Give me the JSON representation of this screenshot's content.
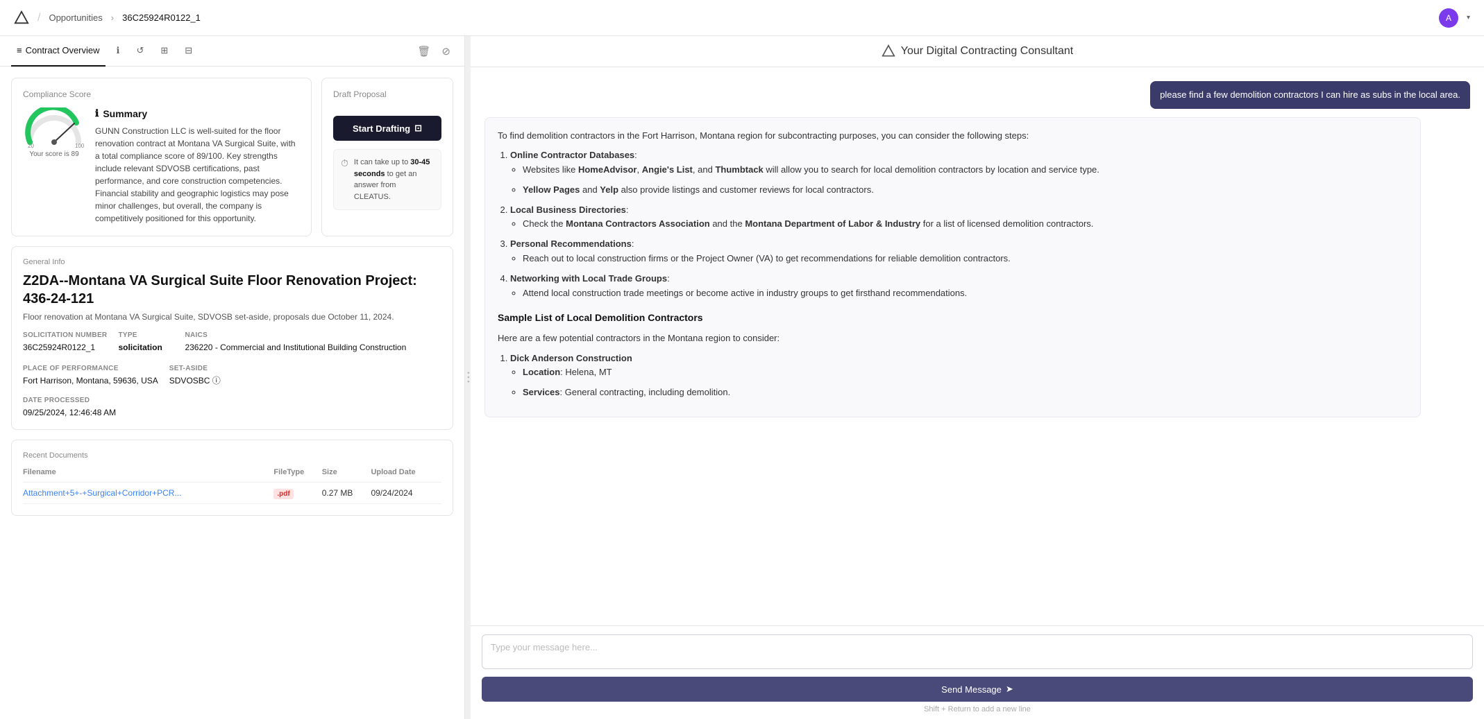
{
  "nav": {
    "breadcrumb": "Opportunities",
    "separator": "/",
    "arrow": "›",
    "current": "36C25924R0122_1",
    "avatar_text": "A",
    "chevron": "▾"
  },
  "tabs": [
    {
      "id": "contract-overview",
      "label": "Contract Overview",
      "icon": "≡",
      "active": true
    },
    {
      "id": "info",
      "label": "",
      "icon": "ℹ",
      "active": false
    },
    {
      "id": "refresh",
      "label": "",
      "icon": "↺",
      "active": false
    },
    {
      "id": "layers",
      "label": "",
      "icon": "⊞",
      "active": false
    },
    {
      "id": "edit",
      "label": "",
      "icon": "⊟",
      "active": false
    }
  ],
  "tab_actions": {
    "delete": "🗑",
    "archive": "⊘"
  },
  "compliance": {
    "section_title": "Compliance Score",
    "score": 89,
    "score_label": "Your score is 89",
    "gauge_min": 20,
    "gauge_max": 100,
    "summary": {
      "title": "Summary",
      "info_icon": "ℹ",
      "text": "GUNN Construction LLC is well-suited for the floor renovation contract at Montana VA Surgical Suite, with a total compliance score of 89/100. Key strengths include relevant SDVOSB certifications, past performance, and core construction competencies. Financial stability and geographic logistics may pose minor challenges, but overall, the company is competitively positioned for this opportunity."
    }
  },
  "draft_proposal": {
    "section_title": "Draft Proposal",
    "button_label": "Start Drafting",
    "button_icon": "⊡",
    "hint_text_1": "It can take up to ",
    "hint_bold": "30-45 seconds",
    "hint_text_2": " to get an answer from CLEATUS."
  },
  "general_info": {
    "section_label": "General Info",
    "project_title": "Z2DA--Montana VA Surgical Suite Floor Renovation Project: 436-24-121",
    "project_subtitle": "Floor renovation at Montana VA Surgical Suite, SDVOSB set-aside, proposals due October 11, 2024.",
    "fields": [
      {
        "label": "SOLICITATION NUMBER",
        "value": "36C25924R0122_1"
      },
      {
        "label": "TYPE",
        "value": "solicitation"
      },
      {
        "label": "NAICS",
        "value": "236220 - Commercial and Institutional Building Construction"
      },
      {
        "label": "PLACE OF PERFORMANCE",
        "value": "Fort Harrison, Montana, 59636, USA"
      },
      {
        "label": "SET-ASIDE",
        "value": "SDVOSBC ⓘ"
      }
    ],
    "date_label": "DATE PROCESSED",
    "date_value": "09/25/2024, 12:46:48 AM"
  },
  "recent_docs": {
    "section_title": "Recent Documents",
    "columns": [
      "Filename",
      "FileType",
      "Size",
      "Upload Date"
    ],
    "rows": [
      {
        "filename": "Attachment+5+-+Surgical+Corridor+PCR...",
        "filetype": ".pdf",
        "size": "0.27 MB",
        "upload_date": "09/24/2024"
      }
    ]
  },
  "right_panel": {
    "header_title": "Your Digital Contracting Consultant",
    "user_message": "please find a few demolition contractors I can hire as subs in the local area.",
    "assistant_intro": "To find demolition contractors in the Fort Harrison, Montana region for subcontracting purposes, you can consider the following steps:",
    "steps": [
      {
        "num": 1,
        "title": "Online Contractor Databases",
        "bullets": [
          {
            "parts": [
              {
                "text": "Websites like ",
                "bold": false
              },
              {
                "text": "HomeAdvisor",
                "bold": true
              },
              {
                "text": ", ",
                "bold": false
              },
              {
                "text": "Angie's List",
                "bold": true
              },
              {
                "text": ", and ",
                "bold": false
              },
              {
                "text": "Thumbtack",
                "bold": true
              },
              {
                "text": " will allow you to search for local demolition contractors by location and service type.",
                "bold": false
              }
            ]
          },
          {
            "parts": [
              {
                "text": "Yellow Pages",
                "bold": true
              },
              {
                "text": " and ",
                "bold": false
              },
              {
                "text": "Yelp",
                "bold": true
              },
              {
                "text": " also provide listings and customer reviews for local contractors.",
                "bold": false
              }
            ]
          }
        ]
      },
      {
        "num": 2,
        "title": "Local Business Directories",
        "bullets": [
          {
            "parts": [
              {
                "text": "Check the ",
                "bold": false
              },
              {
                "text": "Montana Contractors Association",
                "bold": true
              },
              {
                "text": " and the ",
                "bold": false
              },
              {
                "text": "Montana Department of Labor & Industry",
                "bold": true
              },
              {
                "text": " for a list of licensed demolition contractors.",
                "bold": false
              }
            ]
          }
        ]
      },
      {
        "num": 3,
        "title": "Personal Recommendations",
        "bullets": [
          {
            "parts": [
              {
                "text": "Reach out to local construction firms or the Project Owner (VA) to get recommendations for reliable demolition contractors.",
                "bold": false
              }
            ]
          }
        ]
      },
      {
        "num": 4,
        "title": "Networking with Local Trade Groups",
        "bullets": [
          {
            "parts": [
              {
                "text": "Attend local construction trade meetings or become active in industry groups to get firsthand recommendations.",
                "bold": false
              }
            ]
          }
        ]
      }
    ],
    "sample_list_title": "Sample List of Local Demolition Contractors",
    "sample_list_intro": "Here are a few potential contractors in the Montana region to consider:",
    "contractors": [
      {
        "num": 1,
        "name": "Dick Anderson Construction",
        "location": "Helena, MT",
        "services": "General contracting, including demolition."
      }
    ],
    "input_placeholder": "Type your message here...",
    "send_button": "Send Message",
    "send_hint": "Shift + Return to add a new line",
    "send_icon": "➤"
  }
}
